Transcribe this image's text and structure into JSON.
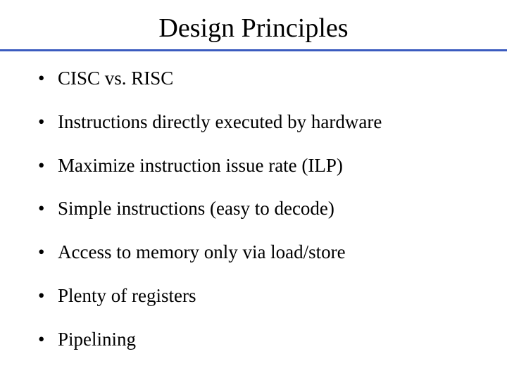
{
  "title": "Design Principles",
  "bullets": [
    "CISC vs. RISC",
    "Instructions directly executed by hardware",
    "Maximize instruction issue rate (ILP)",
    "Simple instructions (easy to decode)",
    "Access to memory only via load/store",
    "Plenty of registers",
    "Pipelining"
  ]
}
